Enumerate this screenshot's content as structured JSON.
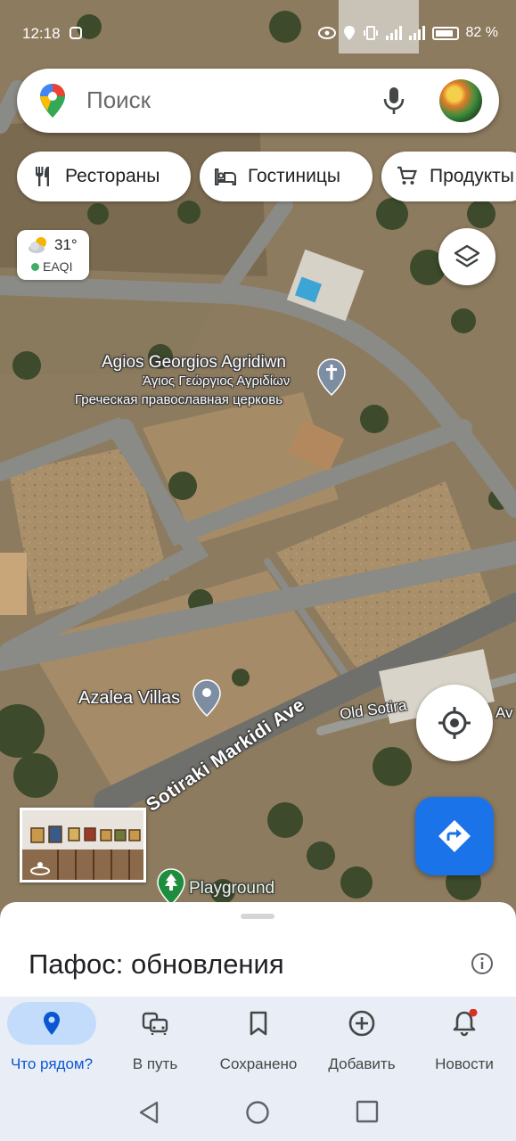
{
  "status_bar": {
    "time": "12:18",
    "battery": "82 %"
  },
  "search": {
    "placeholder": "Поиск"
  },
  "chips": [
    {
      "label": "Рестораны",
      "icon": "restaurant-icon"
    },
    {
      "label": "Гостиницы",
      "icon": "hotel-icon"
    },
    {
      "label": "Продукты",
      "icon": "cart-icon"
    }
  ],
  "weather": {
    "temp": "31°",
    "aqi": "EAQI",
    "icon": "partly-cloudy-icon"
  },
  "map_labels": {
    "church_name_latin": "Agios Georgios Agridiwn",
    "church_name_greek": "Άγιος Γεώργιος Αγριδίων",
    "church_type": "Греческая православная церковь",
    "villas": "Azalea Villas",
    "road_main": "Sotiraki Markidi Ave",
    "road_old": "Old Sotira",
    "road_old_suffix": "Av",
    "playground": "Playground"
  },
  "sheet": {
    "title": "Пафос: обновления"
  },
  "bottom_nav": [
    {
      "label": "Что рядом?",
      "icon": "location-pin-icon",
      "active": true
    },
    {
      "label": "В путь",
      "icon": "commute-icon",
      "active": false
    },
    {
      "label": "Сохранено",
      "icon": "bookmark-icon",
      "active": false
    },
    {
      "label": "Добавить",
      "icon": "add-circle-icon",
      "active": false
    },
    {
      "label": "Новости",
      "icon": "bell-icon",
      "active": false
    }
  ],
  "colors": {
    "accent": "#1a73e8",
    "active_nav": "#0b57d0",
    "nav_pill": "#c4dcfc",
    "notification_dot": "#d93025"
  }
}
